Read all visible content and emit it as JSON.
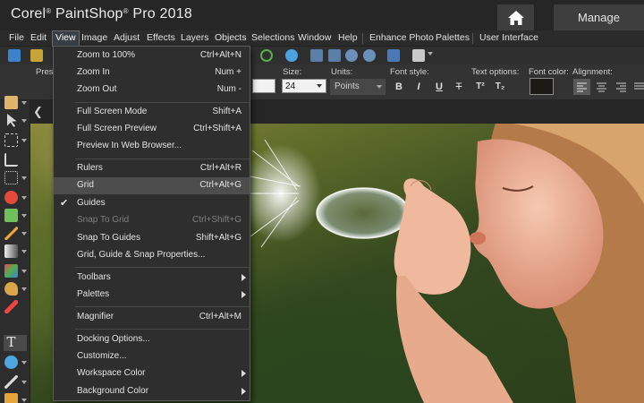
{
  "app": {
    "brand": "Corel",
    "title_rest": "PaintShop",
    "pro": "Pro 2018"
  },
  "title_tabs": {
    "manage": "Manage"
  },
  "menubar": [
    "File",
    "Edit",
    "View",
    "Image",
    "Adjust",
    "Effects",
    "Layers",
    "Objects",
    "Selections",
    "Window",
    "Help",
    "Enhance Photo",
    "Palettes",
    "User Interface"
  ],
  "options": {
    "presets_label": "Pres",
    "size_label": "Size:",
    "size_value": "24",
    "units_label": "Units:",
    "units_value": "Points",
    "font_style_label": "Font style:",
    "text_options_label": "Text options:",
    "font_color_label": "Font color:",
    "font_color": "#1c1a14",
    "alignment_label": "Alignment:",
    "style_buttons": [
      "B",
      "I",
      "U",
      "T"
    ]
  },
  "view_menu": {
    "items": [
      {
        "label": "Zoom to 100%",
        "shortcut": "Ctrl+Alt+N"
      },
      {
        "label": "Zoom In",
        "shortcut": "Num +"
      },
      {
        "label": "Zoom Out",
        "shortcut": "Num -"
      },
      {
        "label": "Full Screen Mode",
        "shortcut": "Shift+A"
      },
      {
        "label": "Full Screen Preview",
        "shortcut": "Ctrl+Shift+A"
      },
      {
        "label": "Preview In Web Browser...",
        "shortcut": ""
      },
      {
        "label": "Rulers",
        "shortcut": "Ctrl+Alt+R"
      },
      {
        "label": "Grid",
        "shortcut": "Ctrl+Alt+G",
        "highlighted": true
      },
      {
        "label": "Guides",
        "shortcut": "",
        "checked": true
      },
      {
        "label": "Snap To Grid",
        "shortcut": "Ctrl+Shift+G",
        "disabled": true
      },
      {
        "label": "Snap To Guides",
        "shortcut": "Shift+Alt+G"
      },
      {
        "label": "Grid, Guide & Snap Properties...",
        "shortcut": ""
      },
      {
        "label": "Toolbars",
        "shortcut": "",
        "submenu": true
      },
      {
        "label": "Palettes",
        "shortcut": "",
        "submenu": true
      },
      {
        "label": "Magnifier",
        "shortcut": "Ctrl+Alt+M"
      },
      {
        "label": "Docking Options...",
        "shortcut": ""
      },
      {
        "label": "Customize...",
        "shortcut": ""
      },
      {
        "label": "Workspace Color",
        "shortcut": "",
        "submenu": true
      },
      {
        "label": "Background Color",
        "shortcut": "",
        "submenu": true
      }
    ]
  },
  "icons": {
    "home": "home-icon",
    "back": "chevron-left-icon",
    "check": "check-icon",
    "submenu": "chevron-right-icon"
  }
}
